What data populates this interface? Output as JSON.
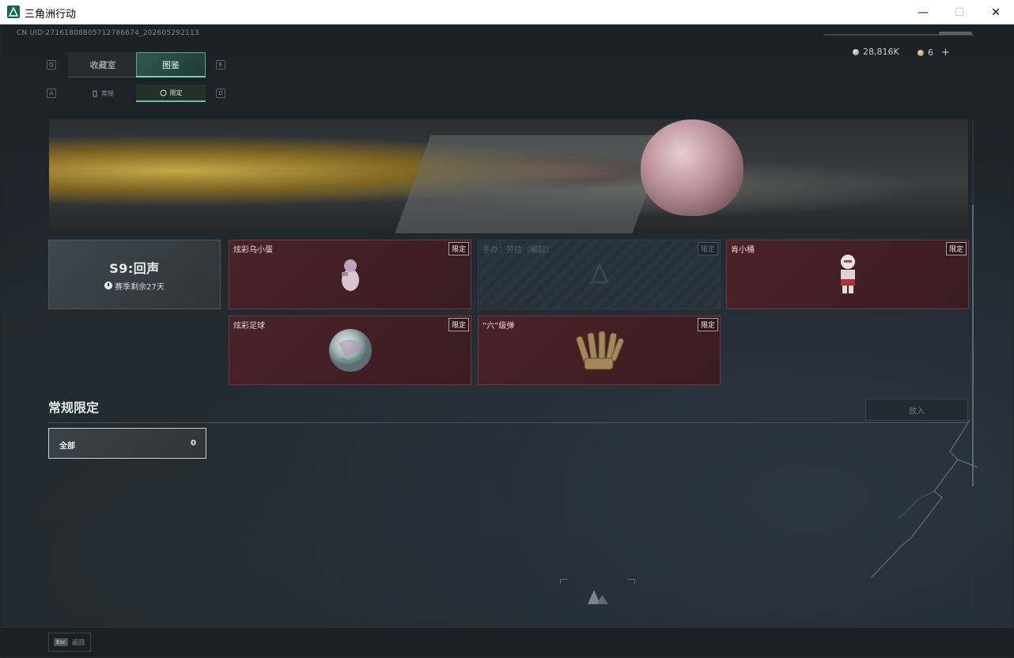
{
  "window": {
    "title": "三角洲行动",
    "minimize_glyph": "—",
    "maximize_glyph": "☐",
    "close_glyph": "✕"
  },
  "header": {
    "uid": "CN UID:2716180880571278667​4_202605292113",
    "currency_silver": "28,816K",
    "currency_gold": "6",
    "add_glyph": "+"
  },
  "tabs": {
    "main": [
      {
        "label": "收藏室",
        "key": "Q",
        "active": false
      },
      {
        "label": "图鉴",
        "key": "E",
        "active": true
      }
    ],
    "sub": [
      {
        "label": "常规",
        "key": "A",
        "active": false
      },
      {
        "label": "限定",
        "key": "D",
        "active": true
      }
    ]
  },
  "season": {
    "name": "S9:回声",
    "remaining": "赛季剩余27天"
  },
  "items": [
    {
      "name": "炫彩乌小蛋",
      "badge": "限定",
      "locked": false,
      "icon": "egg-figure-icon"
    },
    {
      "name": "手办：劳拉（崛起）",
      "badge": "限定",
      "locked": true,
      "icon": "lock-icon"
    },
    {
      "name": "肯小桶",
      "badge": "限定",
      "locked": false,
      "icon": "figure-icon"
    },
    {
      "name": "炫彩足球",
      "badge": "限定",
      "locked": false,
      "icon": "ball-icon"
    },
    {
      "name": "“六”级弹",
      "badge": "限定",
      "locked": false,
      "icon": "bullets-icon"
    }
  ],
  "section": {
    "title": "常规限定",
    "search_label": "放入"
  },
  "filter": {
    "label": "全部",
    "count": "0"
  },
  "footer": {
    "esc_key": "Esc",
    "esc_label": "返回"
  },
  "colors": {
    "accent": "#5fa58b",
    "card_bg": "#4a2228",
    "locked_bg": "#26303a"
  }
}
